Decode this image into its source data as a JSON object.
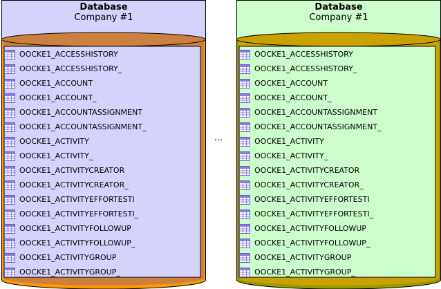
{
  "colors": {
    "left_body": "#d3d3fd",
    "right_body": "#ccfecc",
    "left_drum_fill": "#cc8040",
    "left_drum_shade": "#ff9900",
    "right_drum_fill": "#c9a100",
    "right_drum_shade": "#999900",
    "outline": "#000000"
  },
  "databases": [
    {
      "title": "Database",
      "subtitle": "Company #1",
      "tables": [
        "OOCKE1_ACCESSHISTORY",
        "OOCKE1_ACCESSHISTORY_",
        "OOCKE1_ACCOUNT",
        "OOCKE1_ACCOUNT_",
        "OOCKE1_ACCOUNTASSIGNMENT",
        "OOCKE1_ACCOUNTASSIGNMENT_",
        "OOCKE1_ACTIVITY",
        "OOCKE1_ACTIVITY_",
        "OOCKE1_ACTIVITYCREATOR",
        "OOCKE1_ACTIVITYCREATOR_",
        "OOCKE1_ACTIVITYEFFORTESTI",
        "OOCKE1_ACTIVITYEFFORTESTI_",
        "OOCKE1_ACTIVITYFOLLOWUP",
        "OOCKE1_ACTIVITYFOLLOWUP_",
        "OOCKE1_ACTIVITYGROUP",
        "OOCKE1_ACTIVITYGROUP_"
      ]
    },
    {
      "title": "Database",
      "subtitle": "Company #1",
      "tables": [
        "OOCKE1_ACCESSHISTORY",
        "OOCKE1_ACCESSHISTORY_",
        "OOCKE1_ACCOUNT",
        "OOCKE1_ACCOUNT_",
        "OOCKE1_ACCOUNTASSIGNMENT",
        "OOCKE1_ACCOUNTASSIGNMENT_",
        "OOCKE1_ACTIVITY",
        "OOCKE1_ACTIVITY_",
        "OOCKE1_ACTIVITYCREATOR",
        "OOCKE1_ACTIVITYCREATOR_",
        "OOCKE1_ACTIVITYEFFORTESTI",
        "OOCKE1_ACTIVITYEFFORTESTI_",
        "OOCKE1_ACTIVITYFOLLOWUP",
        "OOCKE1_ACTIVITYFOLLOWUP_",
        "OOCKE1_ACTIVITYGROUP",
        "OOCKE1_ACTIVITYGROUP_"
      ]
    }
  ],
  "separator": "...",
  "table_icon": "table-icon"
}
